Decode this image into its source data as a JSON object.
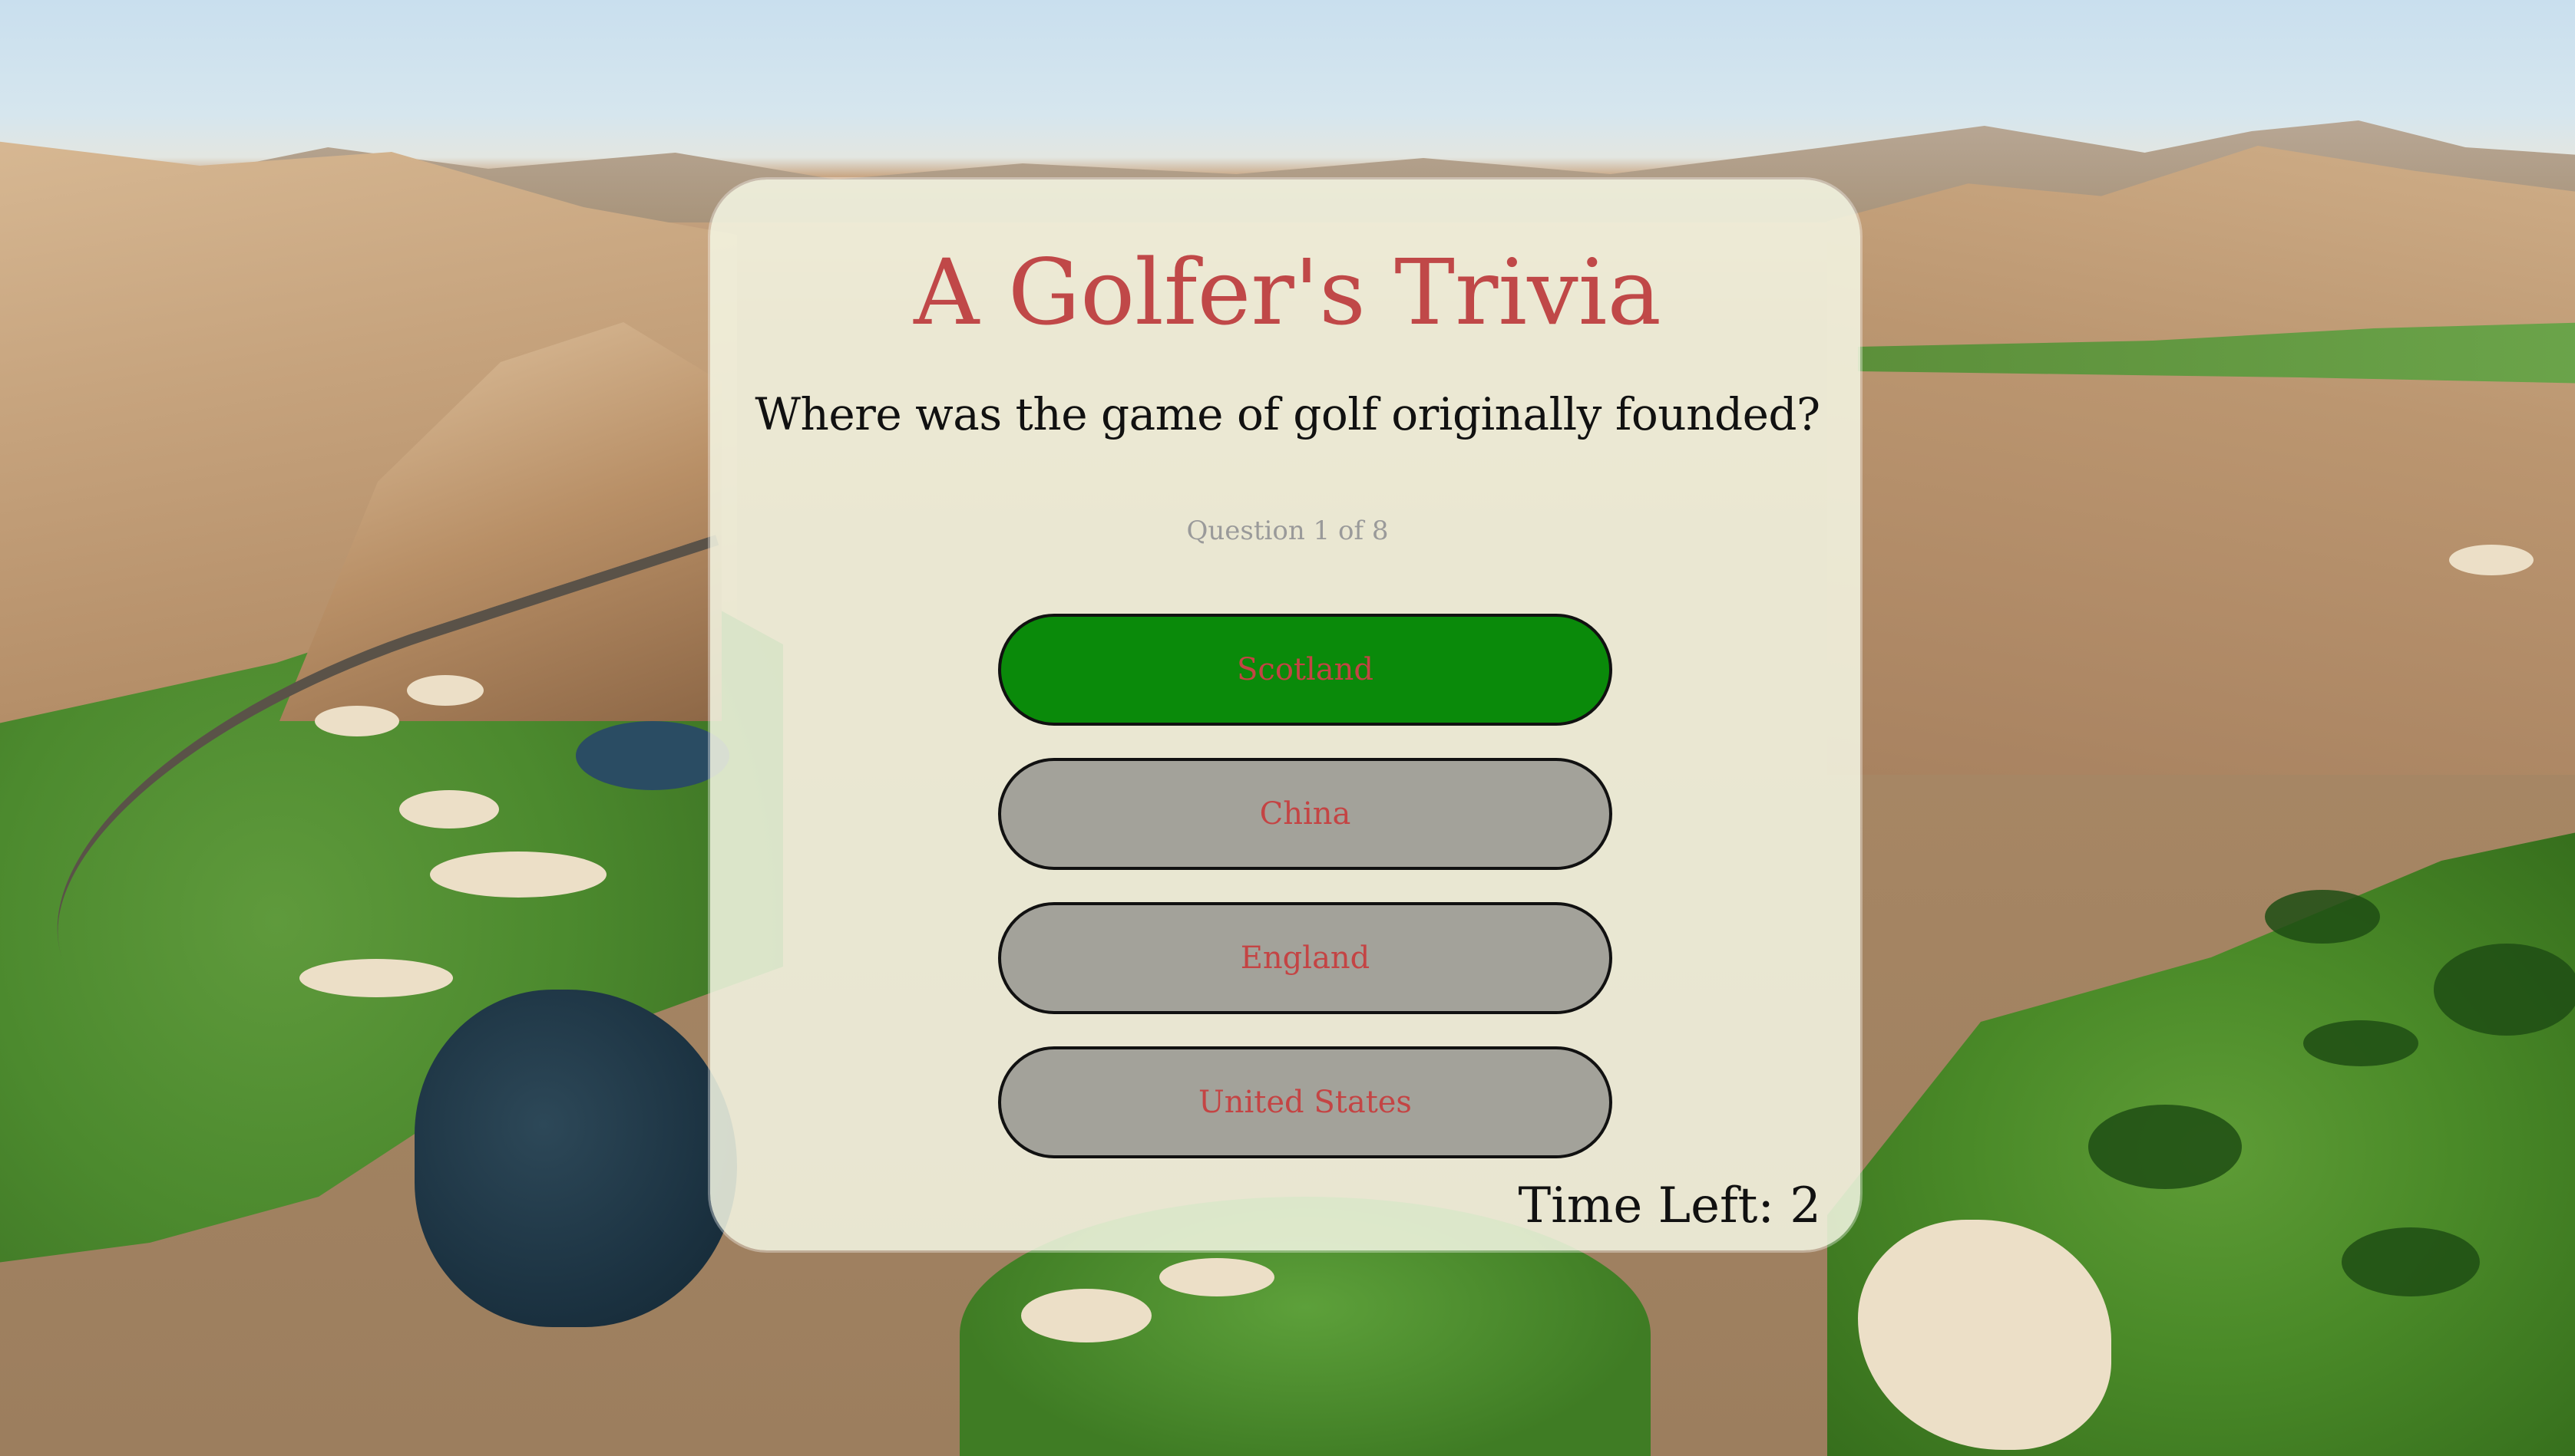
{
  "quiz": {
    "title": "A Golfer's Trivia",
    "question": "Where was the game of golf originally founded?",
    "counter": "Question 1 of 8",
    "answers": [
      {
        "label": "Scotland",
        "state": "correct"
      },
      {
        "label": "China",
        "state": "neutral"
      },
      {
        "label": "England",
        "state": "neutral"
      },
      {
        "label": "United States",
        "state": "neutral"
      }
    ],
    "timer": "Time Left: 2"
  },
  "colors": {
    "title": "#c04848",
    "answer_text": "#c44444",
    "correct_bg": "#0a8a0a",
    "neutral_bg": "#787878",
    "card_bg": "#f5f7e4"
  },
  "background": {
    "description_icon": "golf-course-landscape"
  }
}
